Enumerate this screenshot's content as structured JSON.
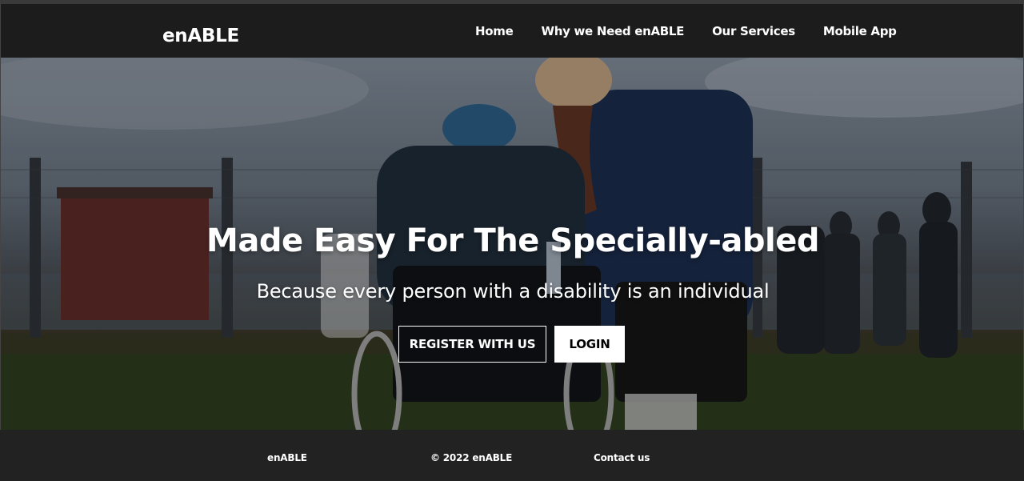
{
  "brand": "enABLE",
  "nav": {
    "items": [
      "Home",
      "Why we Need enABLE",
      "Our Services",
      "Mobile App"
    ]
  },
  "hero": {
    "title": "Made Easy For The Specially-abled",
    "subtitle": "Because every person with a disability is an individual",
    "register_label": "REGISTER WITH US",
    "login_label": "LOGIN",
    "background_image": "person-in-wheelchair-photo"
  },
  "footer": {
    "brand": "enABLE",
    "copyright": "© 2022 enABLE",
    "contact": "Contact us"
  },
  "colors": {
    "navbar": "#1c1c1c",
    "footer": "#222222",
    "text": "#ffffff",
    "login_button_bg": "#ffffff",
    "login_button_text": "#000000"
  }
}
